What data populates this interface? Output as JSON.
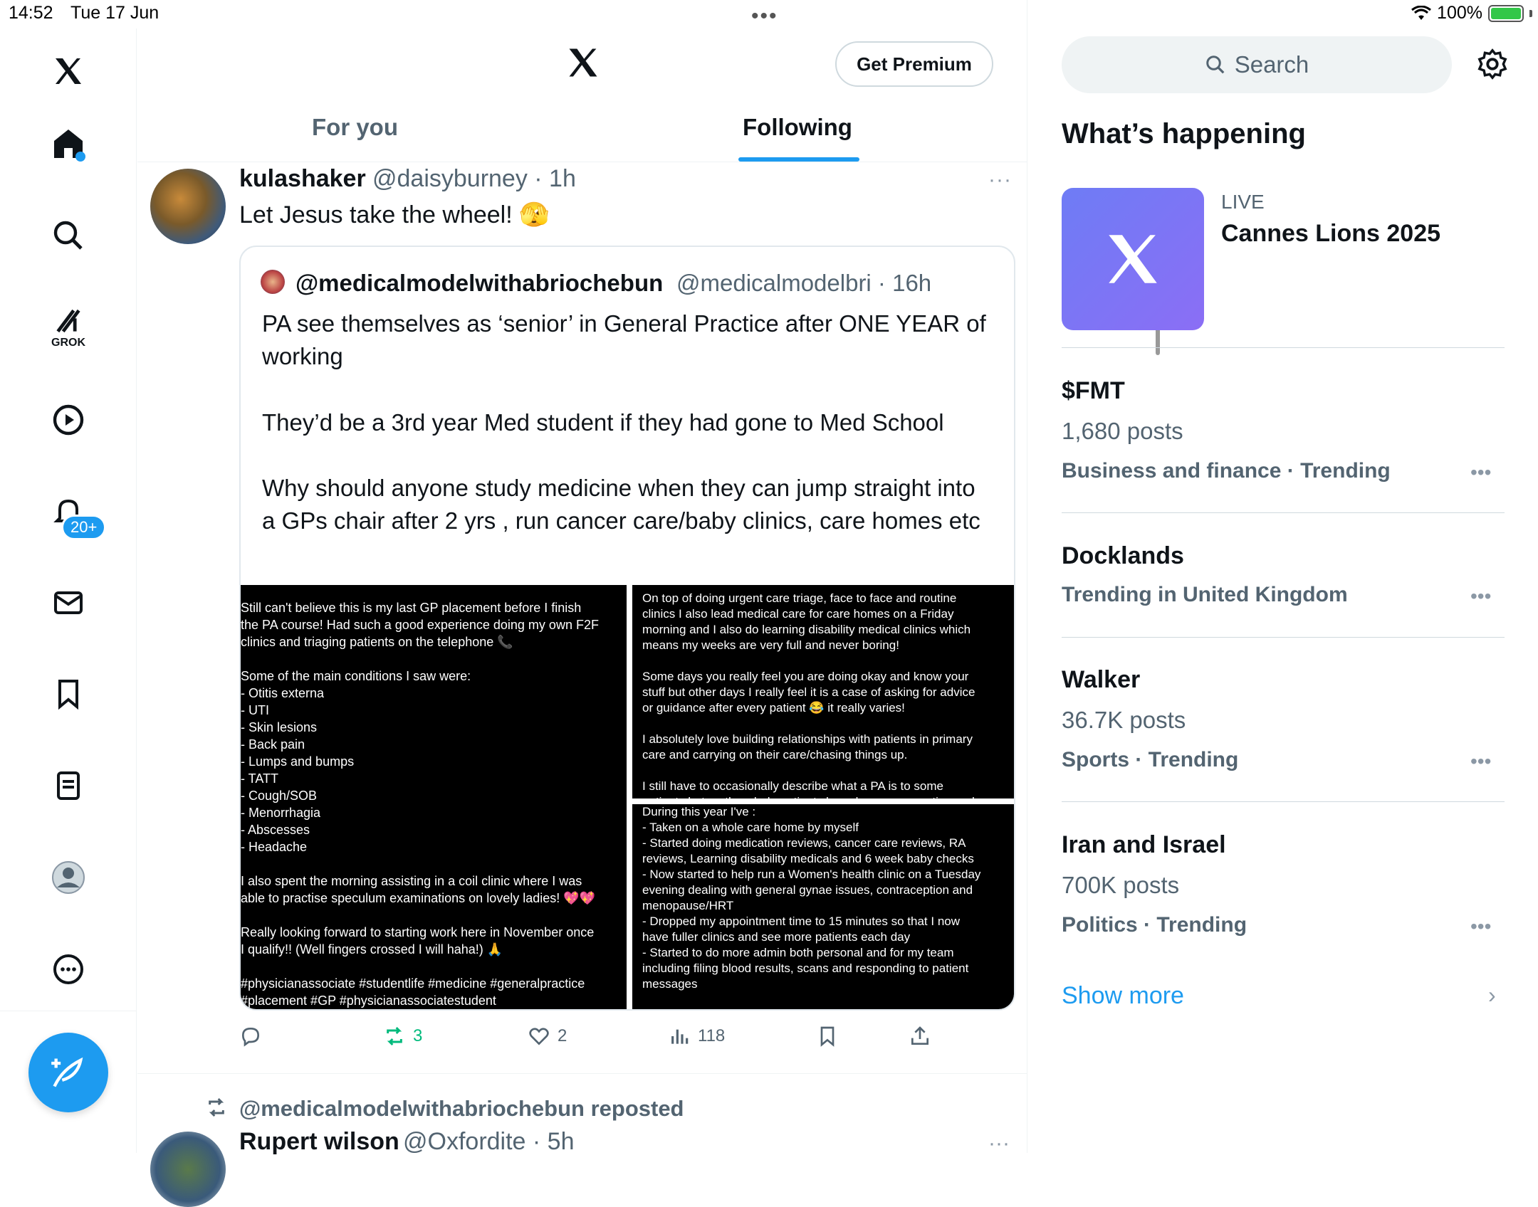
{
  "status_bar": {
    "time": "14:52",
    "date": "Tue 17 Jun",
    "battery": "100%"
  },
  "nav": {
    "grok_label": "GROK",
    "notif_count": "20+"
  },
  "header": {
    "premium_label": "Get Premium",
    "tabs": [
      {
        "label": "For you"
      },
      {
        "label": "Following"
      }
    ]
  },
  "post": {
    "name": "kulashaker",
    "handle": "@daisyburney · 1h",
    "text": "Let Jesus take the wheel! 🫣",
    "more": "···",
    "quote": {
      "name": "@medicalmodelwithabriochebun",
      "handle": "@medicalmodelbri · 16h",
      "para1": "PA see themselves as ‘senior’ in General Practice after ONE YEAR of working",
      "para2": "They’d be a 3rd year Med student if they had gone to Med School",
      "para3": "Why should anyone study medicine when they can jump straight into a GPs chair after 2 yrs , run cancer care/baby clinics, care homes etc",
      "img_left": "Still can't believe this is my last GP placement before I finish\nthe PA course! Had such a good experience doing my own F2F\nclinics and triaging patients on the telephone 📞\n\nSome of the main conditions I saw were:\n- Otitis externa\n- UTI\n- Skin lesions\n- Back pain\n- Lumps and bumps\n- TATT\n- Cough/SOB\n- Menorrhagia\n- Abscesses\n- Headache\n\nI also spent the morning assisting in a coil clinic where I was\nable to practise speculum examinations on lovely ladies! 💖💖\n\nReally looking forward to starting work here in November once\nI qualify!! (Well fingers crossed I will haha!) 🙏\n\n#physicianassociate #studentlife #medicine #generalpractice\n#placement #GP #physicianassociatestudent\n#physicianassociateuk",
      "img_right_top": "On top of doing urgent care triage, face to face and routine\nclinics I also lead medical care for care homes on a Friday\nmorning and I also do learning disability medical clinics which\nmeans my weeks are very full and never boring!\n\nSome days you really feel you are doing okay and know your\nstuff but other days I really feel it is a case of asking for advice\nor guidance after every patient 😂 it really varies!\n\nI absolutely love building relationships with patients in primary\ncare and carrying on their care/chasing things up.\n\nI still have to occasionally describe what a PA is to some\npatients but on the whole patients have been so receptive and",
      "img_right_bottom": "During this year I've :\n- Taken on a whole care home by myself\n- Started doing medication reviews, cancer care reviews, RA\nreviews, Learning disability medicals and 6 week baby checks\n- Now started to help run a Women's health clinic on a Tuesday\nevening dealing with general gynae issues, contraception and\nmenopause/HRT\n- Dropped my appointment time to 15 minutes so that I now\nhave fuller clinics and see more patients each day\n- Started to do more admin both personal and for my team\nincluding filing blood results, scans and responding to patient\nmessages\n\nIt's has been so great branching out and finding out what I'm"
    },
    "actions": {
      "reposts": "3",
      "likes": "2",
      "views": "118"
    }
  },
  "post2": {
    "repost_text": "@medicalmodelwithabriochebun reposted",
    "name": "Rupert wilson",
    "handle": "@Oxfordite · 5h",
    "more": "···"
  },
  "sidebar": {
    "search_placeholder": "Search",
    "whats_happening": "What’s happening",
    "live": {
      "label": "LIVE",
      "title": "Cannes Lions 2025"
    },
    "trends": [
      {
        "title": "$FMT",
        "posts": "1,680 posts",
        "meta": "Business and finance · Trending"
      },
      {
        "title": "Docklands",
        "posts": "",
        "meta": "Trending in United Kingdom"
      },
      {
        "title": "Walker",
        "posts": "36.7K posts",
        "meta": "Sports · Trending"
      },
      {
        "title": "Iran and Israel",
        "posts": "700K posts",
        "meta": "Politics · Trending"
      }
    ],
    "show_more": "Show more"
  },
  "colors": {
    "accent": "#1d9bf0",
    "text": "#0f1419",
    "muted": "#536471",
    "repost_green": "#00ba7c"
  }
}
